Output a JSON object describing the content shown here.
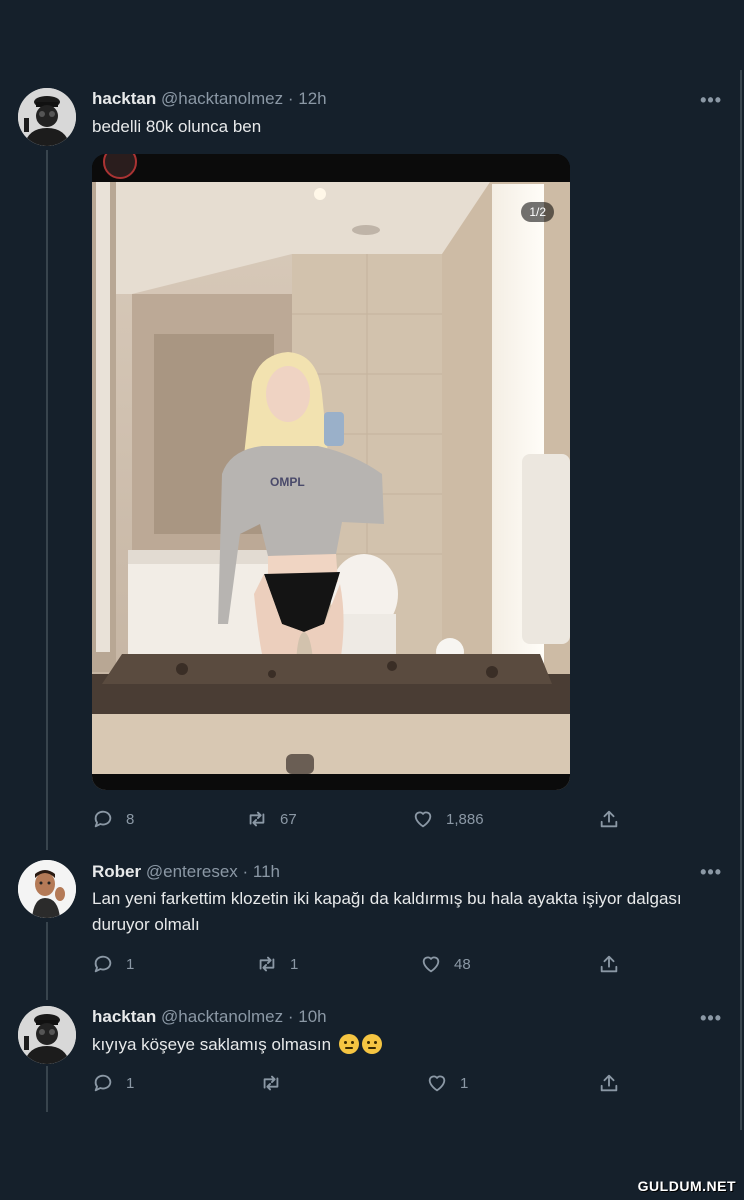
{
  "tweets": [
    {
      "name": "hacktan",
      "handle": "@hacktanolmez",
      "time": "· 12h",
      "text": "bedelli 80k olunca ben",
      "media_counter": "1/2",
      "replies": "8",
      "retweets": "67",
      "likes": "1,886"
    },
    {
      "name": "Rober",
      "handle": "@enteresex",
      "time": "· 11h",
      "text": "Lan yeni farkettim klozetin iki kapağı da kaldırmış bu hala ayakta işiyor dalgası duruyor olmalı",
      "replies": "1",
      "retweets": "1",
      "likes": "48"
    },
    {
      "name": "hacktan",
      "handle": "@hacktanolmez",
      "time": "· 10h",
      "text": "kıyıya köşeye saklamış olmasın",
      "replies": "1",
      "retweets": "",
      "likes": "1"
    }
  ],
  "more_label": "•••",
  "watermark": "GULDUM.NET",
  "icons": {
    "reply": "reply-icon",
    "retweet": "retweet-icon",
    "like": "heart-icon",
    "share": "share-icon",
    "more": "more-icon"
  },
  "colors": {
    "background": "#15202b",
    "text": "#e7e9ea",
    "muted": "#8b98a5",
    "thread": "#38444d"
  }
}
